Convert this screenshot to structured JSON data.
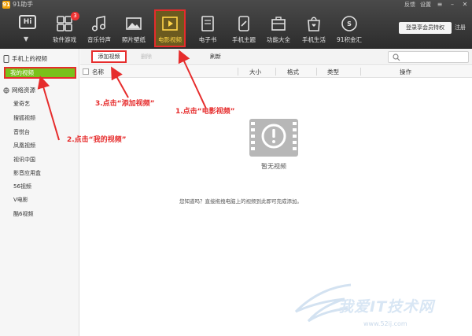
{
  "app": {
    "title": "91助手",
    "logo_glyph": "91"
  },
  "window_controls": {
    "feedback": "反馈",
    "settings": "设置"
  },
  "avatar": {
    "icon_text": "Hi",
    "caret": "▼"
  },
  "nav": [
    {
      "label": "软件游戏",
      "icon": "apps-icon",
      "badge": "3"
    },
    {
      "label": "音乐铃声",
      "icon": "music-icon"
    },
    {
      "label": "照片壁纸",
      "icon": "picture-icon"
    },
    {
      "label": "电影视频",
      "icon": "video-icon",
      "active": true
    },
    {
      "label": "电子书",
      "icon": "book-icon"
    },
    {
      "label": "手机主题",
      "icon": "theme-icon"
    },
    {
      "label": "功能大全",
      "icon": "toolbox-icon"
    },
    {
      "label": "手机生活",
      "icon": "bag-icon"
    },
    {
      "label": "91积金汇",
      "icon": "coin-icon"
    }
  ],
  "vip_button": "登录享会员特权",
  "logout_link": "注册",
  "sidebar": {
    "phone_section": "手机上的视频",
    "my_videos": "我的视频",
    "network_section": "网络资源",
    "items": [
      "爱奇艺",
      "搜狐视频",
      "音悦台",
      "凤凰视频",
      "视讯中国",
      "影音应用盒",
      "56视频",
      "V电影",
      "酷6视频"
    ]
  },
  "toolbar": {
    "add": "添加视频",
    "delete": "删除",
    "refresh": "刷新",
    "search_placeholder": ""
  },
  "table": {
    "headers": [
      "名称",
      "大小",
      "格式",
      "类型",
      "操作"
    ]
  },
  "empty": {
    "title": "暂无视频",
    "tip": "您知道吗？直接拖拽电脑上的视频到此即可完成添加。"
  },
  "annotations": {
    "step1": "1.点击“电影视频”",
    "step2": "2.点击“我的视频”",
    "step3": "3.点击“添加视频”"
  },
  "watermark": {
    "main": "我爱IT技术网",
    "url": "www.52ij.com"
  },
  "colors": {
    "accent_red": "#e62c2c",
    "green": "#79c11a",
    "topbar": "#333333"
  }
}
